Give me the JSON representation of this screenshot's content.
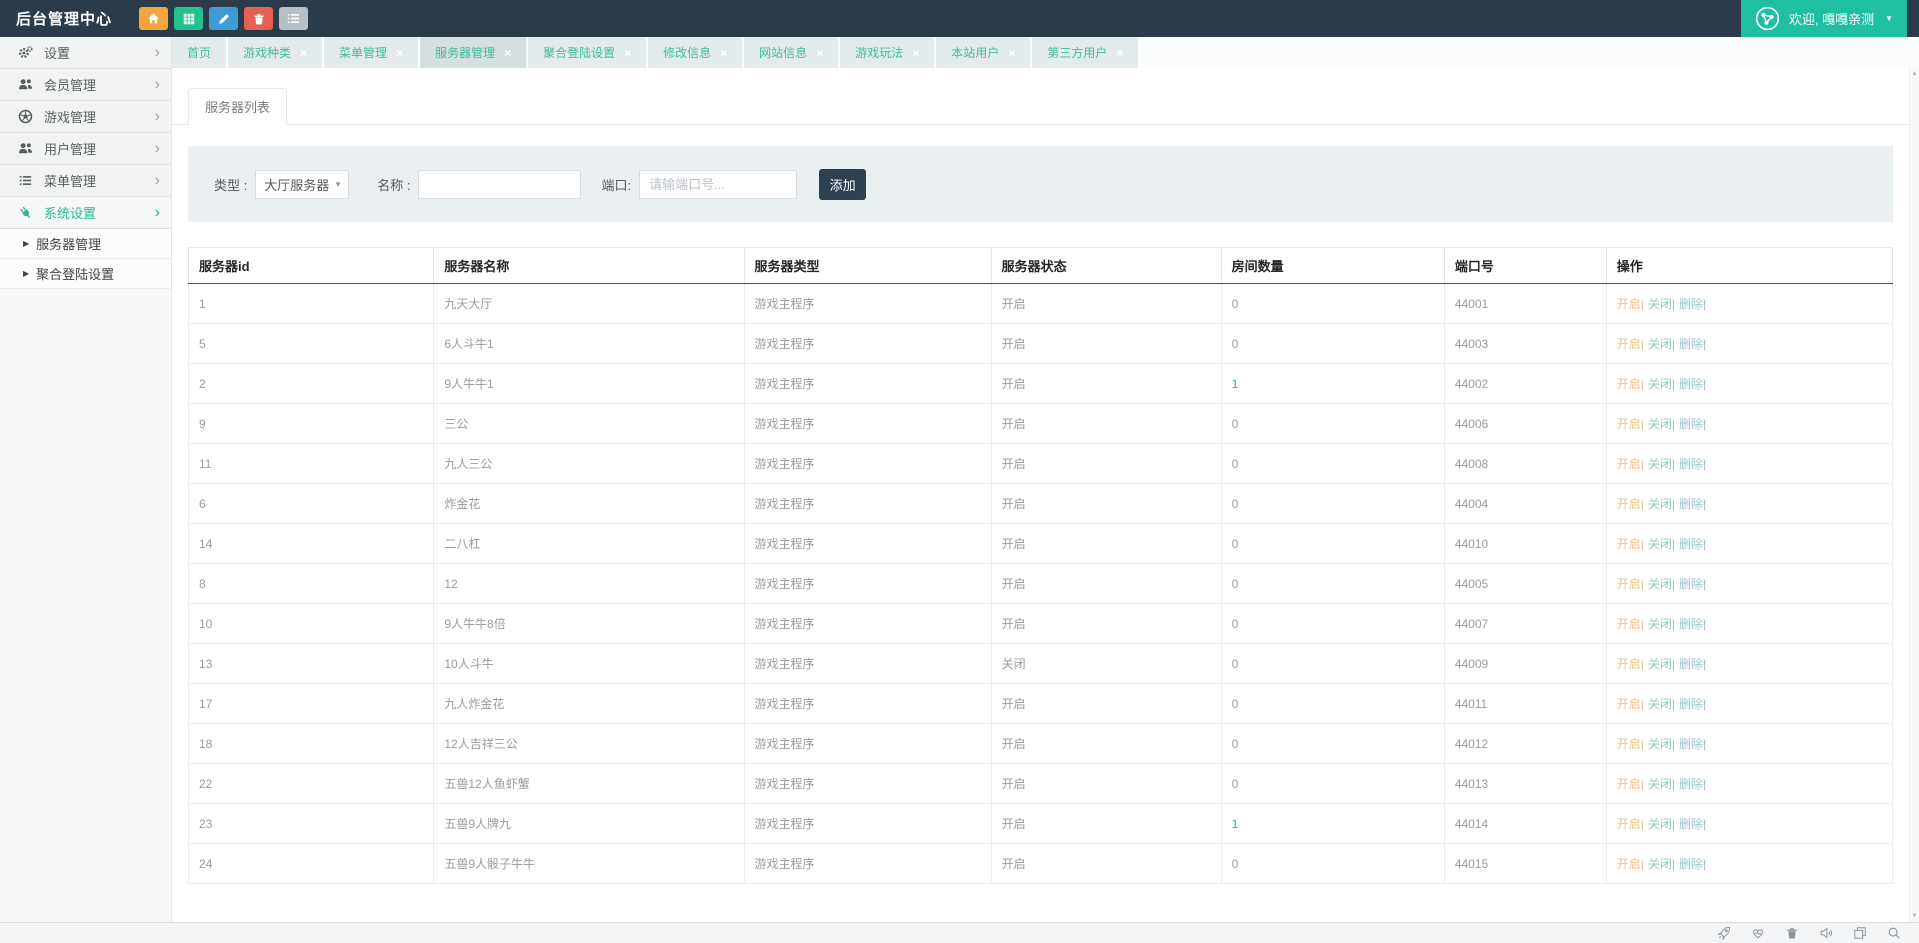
{
  "topbar": {
    "title": "后台管理中心",
    "quick_buttons": [
      {
        "icon": "home-icon",
        "color": "#f5a33c"
      },
      {
        "icon": "grid-icon",
        "color": "#22c28d"
      },
      {
        "icon": "pencil-icon",
        "color": "#3f9bd8"
      },
      {
        "icon": "trash-icon",
        "color": "#e5604f"
      },
      {
        "icon": "list-icon",
        "color": "#b8bfc5"
      }
    ],
    "user_button": {
      "label": "欢迎, 嘎嘎亲测",
      "caret": "▼",
      "icon": "share-network-icon",
      "color": "#1fbfa2"
    }
  },
  "sidebar": {
    "items": [
      {
        "icon": "gears-icon",
        "label": "设置",
        "active": false
      },
      {
        "icon": "users-icon",
        "label": "会员管理",
        "active": false
      },
      {
        "icon": "ball-icon",
        "label": "游戏管理",
        "active": false
      },
      {
        "icon": "users-icon",
        "label": "用户管理",
        "active": false
      },
      {
        "icon": "list-icon",
        "label": "菜单管理",
        "active": false
      },
      {
        "icon": "plug-icon",
        "label": "系统设置",
        "active": true
      }
    ],
    "submenu": [
      {
        "label": "服务器管理"
      },
      {
        "label": "聚合登陆设置"
      }
    ],
    "chevron": "›",
    "sub_arrow": "▶"
  },
  "tabs": [
    {
      "label": "首页",
      "closable": false,
      "active": false
    },
    {
      "label": "游戏种类",
      "closable": true,
      "active": false
    },
    {
      "label": "菜单管理",
      "closable": true,
      "active": false
    },
    {
      "label": "服务器管理",
      "closable": true,
      "active": true
    },
    {
      "label": "聚合登陆设置",
      "closable": true,
      "active": false
    },
    {
      "label": "修改信息",
      "closable": true,
      "active": false
    },
    {
      "label": "网站信息",
      "closable": true,
      "active": false
    },
    {
      "label": "游戏玩法",
      "closable": true,
      "active": false
    },
    {
      "label": "本站用户",
      "closable": true,
      "active": false
    },
    {
      "label": "第三方用户",
      "closable": true,
      "active": false
    }
  ],
  "panel": {
    "title": "服务器列表"
  },
  "filter": {
    "type_label": "类型 :",
    "type_value": "大厅服务器",
    "type_caret": "▾",
    "name_label": "名称 :",
    "name_value": "",
    "port_label": "端口:",
    "port_placeholder": "请输端口号...",
    "add_label": "添加"
  },
  "table": {
    "columns": [
      "服务器id",
      "服务器名称",
      "服务器类型",
      "服务器状态",
      "房间数量",
      "端口号",
      "操作"
    ],
    "op_links": [
      {
        "label": "开启|",
        "color": "#eec28d"
      },
      {
        "label": "关闭|",
        "color": "#8fccb8"
      },
      {
        "label": "删除|",
        "color": "#9cc5cc"
      }
    ],
    "rows": [
      {
        "id": "1",
        "name": "九天大厅",
        "type": "游戏主程序",
        "status": "开启",
        "rooms": "0",
        "port": "44001"
      },
      {
        "id": "5",
        "name": "6人斗牛1",
        "type": "游戏主程序",
        "status": "开启",
        "rooms": "0",
        "port": "44003"
      },
      {
        "id": "2",
        "name": "9人牛牛1",
        "type": "游戏主程序",
        "status": "开启",
        "rooms": "1",
        "port": "44002"
      },
      {
        "id": "9",
        "name": "三公",
        "type": "游戏主程序",
        "status": "开启",
        "rooms": "0",
        "port": "44006"
      },
      {
        "id": "11",
        "name": "九人三公",
        "type": "游戏主程序",
        "status": "开启",
        "rooms": "0",
        "port": "44008"
      },
      {
        "id": "6",
        "name": "炸金花",
        "type": "游戏主程序",
        "status": "开启",
        "rooms": "0",
        "port": "44004"
      },
      {
        "id": "14",
        "name": "二八杠",
        "type": "游戏主程序",
        "status": "开启",
        "rooms": "0",
        "port": "44010"
      },
      {
        "id": "8",
        "name": "12",
        "type": "游戏主程序",
        "status": "开启",
        "rooms": "0",
        "port": "44005"
      },
      {
        "id": "10",
        "name": "9人牛牛8倍",
        "type": "游戏主程序",
        "status": "开启",
        "rooms": "0",
        "port": "44007"
      },
      {
        "id": "13",
        "name": "10人斗牛",
        "type": "游戏主程序",
        "status": "关闭",
        "rooms": "0",
        "port": "44009"
      },
      {
        "id": "17",
        "name": "九人炸金花",
        "type": "游戏主程序",
        "status": "开启",
        "rooms": "0",
        "port": "44011"
      },
      {
        "id": "18",
        "name": "12人吉祥三公",
        "type": "游戏主程序",
        "status": "开启",
        "rooms": "0",
        "port": "44012"
      },
      {
        "id": "22",
        "name": "五兽12人鱼虾蟹",
        "type": "游戏主程序",
        "status": "开启",
        "rooms": "0",
        "port": "44013"
      },
      {
        "id": "23",
        "name": "五兽9人牌九",
        "type": "游戏主程序",
        "status": "开启",
        "rooms": "1",
        "port": "44014"
      },
      {
        "id": "24",
        "name": "五兽9人骰子牛牛",
        "type": "游戏主程序",
        "status": "开启",
        "rooms": "0",
        "port": "44015"
      }
    ]
  },
  "statusbar": {
    "icons": [
      "rocket-icon",
      "heart-pulse-icon",
      "trash-icon",
      "speaker-icon",
      "windows-icon",
      "search-icon"
    ]
  },
  "scrollbar": {
    "up": "▲",
    "down": "▼"
  },
  "colors": {
    "accent_teal": "#26b99a",
    "topbar_bg": "#2b3b4a",
    "add_button_bg": "#2f4050"
  }
}
